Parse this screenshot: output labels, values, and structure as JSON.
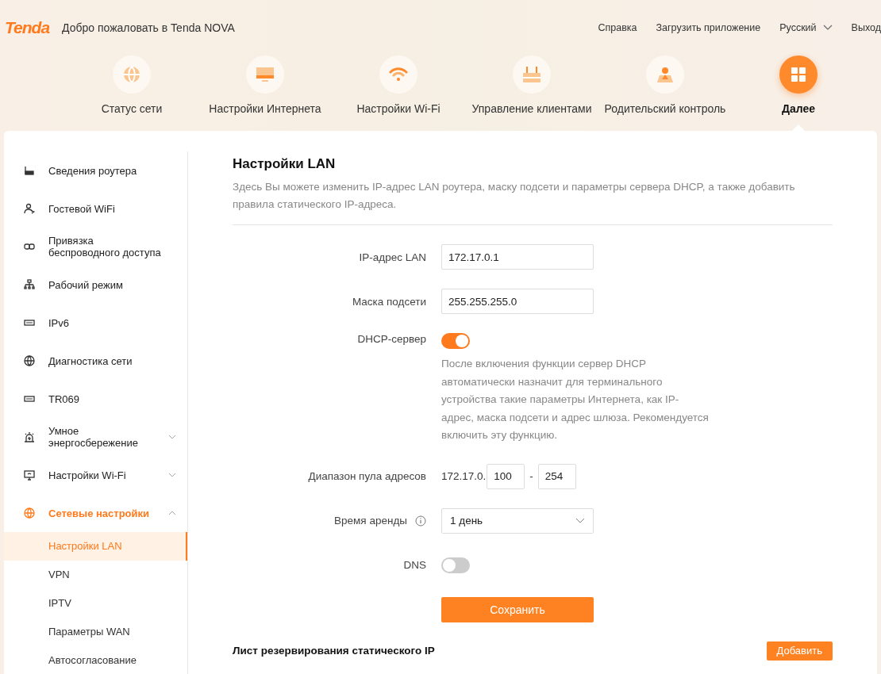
{
  "header": {
    "logo": "Tenda",
    "welcome": "Добро пожаловать в Tenda NOVA",
    "links": [
      {
        "label": "Справка",
        "kind": "link"
      },
      {
        "label": "Загрузить приложение",
        "kind": "link"
      },
      {
        "label": "Русский",
        "kind": "dropdown"
      },
      {
        "label": "Выход",
        "kind": "link"
      }
    ]
  },
  "nav": [
    {
      "label": "Статус сети",
      "selected": false
    },
    {
      "label": "Настройки Интернета",
      "selected": false
    },
    {
      "label": "Настройки Wi-Fi",
      "selected": false
    },
    {
      "label": "Управление клиентами",
      "selected": false
    },
    {
      "label": "Родительский контроль",
      "selected": false
    },
    {
      "label": "Далее",
      "selected": true
    }
  ],
  "sidebar": [
    {
      "label": "Сведения роутера",
      "selected": false
    },
    {
      "label": "Гостевой WiFi",
      "selected": false
    },
    {
      "label": "Привязка беспроводного доступа",
      "selected": false
    },
    {
      "label": "Рабочий режим",
      "selected": false
    },
    {
      "label": "IPv6",
      "selected": false
    },
    {
      "label": "Диагностика сети",
      "selected": false
    },
    {
      "label": "TR069",
      "selected": false
    },
    {
      "label": "Умное энергосбережение",
      "selected": false,
      "expanded": false
    },
    {
      "label": "Настройки Wi-Fi",
      "selected": false,
      "expanded": false
    },
    {
      "label": "Сетевые настройки",
      "selected": true,
      "expanded": true,
      "children": [
        {
          "label": "Настройки LAN",
          "selected": true
        },
        {
          "label": "VPN",
          "selected": false
        },
        {
          "label": "IPTV",
          "selected": false
        },
        {
          "label": "Параметры WAN",
          "selected": false
        },
        {
          "label": "Автосогласование",
          "selected": false
        }
      ]
    }
  ],
  "content": {
    "title": "Настройки LAN",
    "description": "Здесь Вы можете изменить IP-адрес LAN роутера, маску подсети и параметры сервера DHCP, а также добавить правила статического IP-адреса.",
    "lan_ip": {
      "label": "IP-адрес LAN",
      "value": "172.17.0.1"
    },
    "subnet_mask": {
      "label": "Маска подсети",
      "value": "255.255.255.0"
    },
    "dhcp_server": {
      "label": "DHCP-сервер",
      "on": true,
      "note": "После включения функции сервер DHCP автоматически назначит для терминального устройства такие параметры Интернета, как IP-адрес, маска подсети и адрес шлюза. Рекомендуется включить эту функцию."
    },
    "address_pool": {
      "label": "Диапазон пула адресов",
      "prefix": "172.17.0.",
      "start": "100",
      "separator": "-",
      "end": "254"
    },
    "lease_time": {
      "label": "Время аренды",
      "value": "1 день"
    },
    "dns": {
      "label": "DNS",
      "on": false
    },
    "save_button": "Сохранить",
    "reservation": {
      "title": "Лист резервирования статического IP",
      "add_button": "Добавить"
    }
  }
}
